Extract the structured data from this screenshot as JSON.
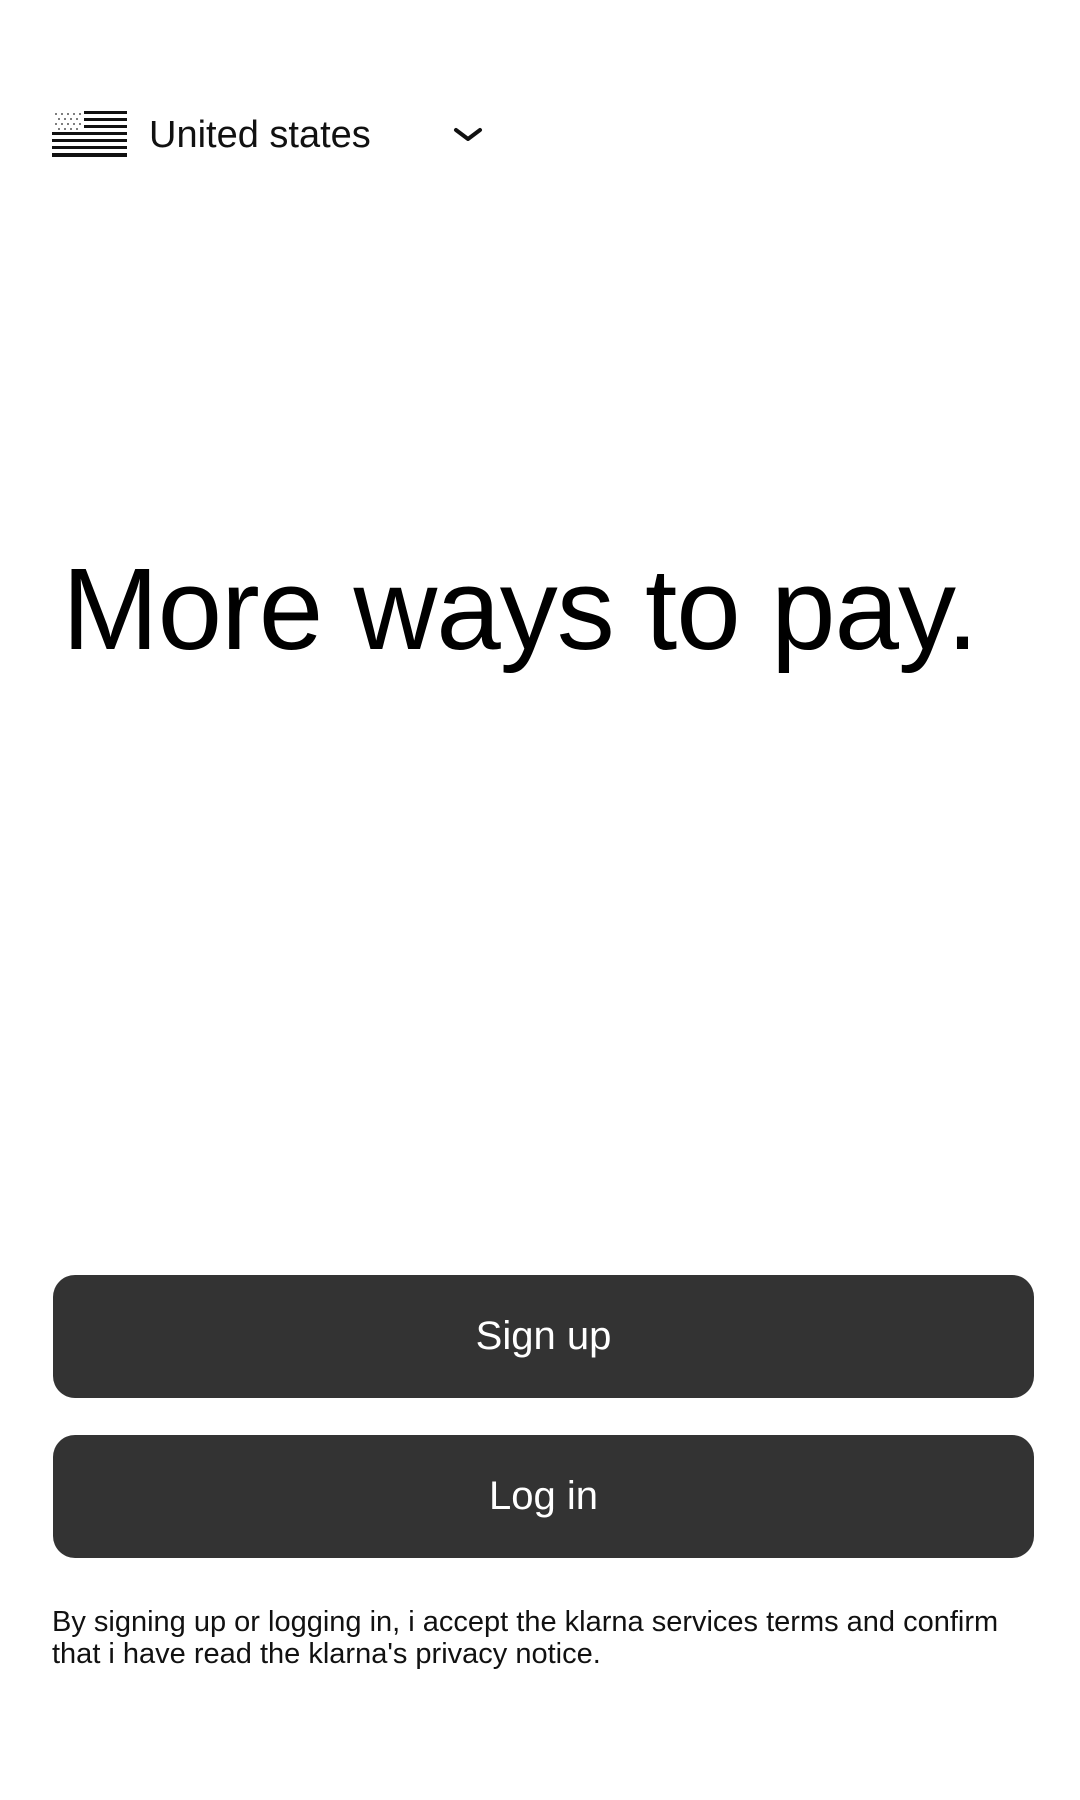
{
  "country_selector": {
    "label": "United states",
    "flag_icon": "us-flag-icon",
    "dropdown_icon": "chevron-down-icon"
  },
  "hero": {
    "headline": "More ways to pay."
  },
  "actions": {
    "signup_label": "Sign up",
    "login_label": "Log in"
  },
  "legal": {
    "text": "By signing up or logging in, i accept the klarna services terms and confirm that i have read the klarna's privacy notice."
  },
  "colors": {
    "background": "#ffffff",
    "button_bg": "#333333",
    "button_text": "#ffffff",
    "text": "#111111"
  }
}
